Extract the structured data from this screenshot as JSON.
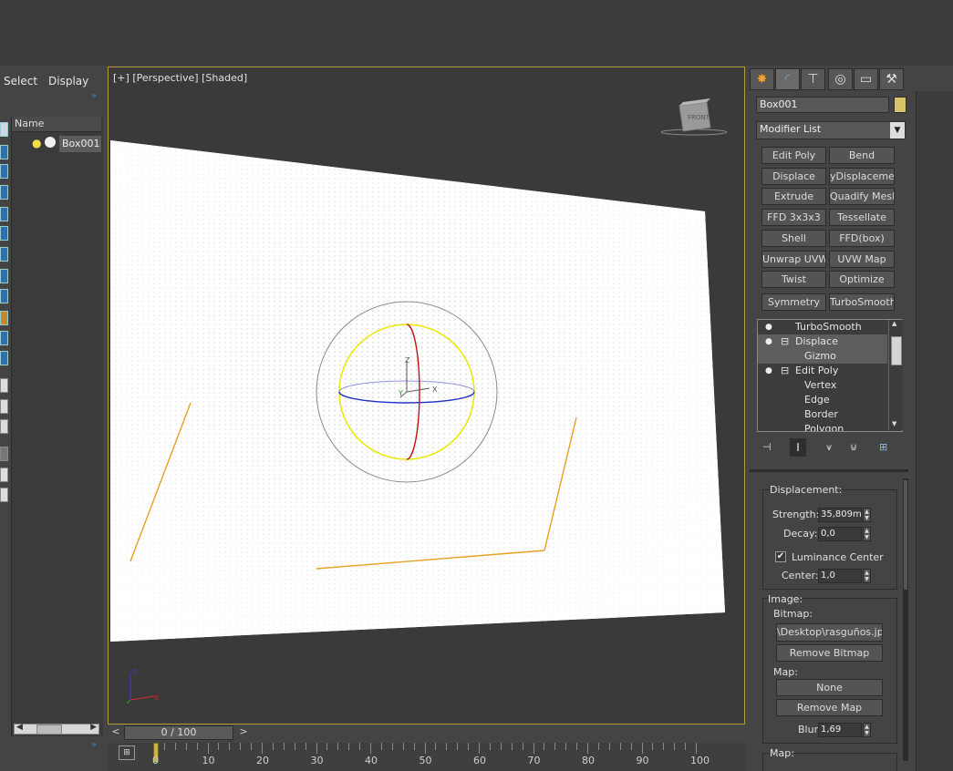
{
  "menu": {
    "select": "Select",
    "display": "Display",
    "more": "»"
  },
  "explorer": {
    "header": "Name",
    "objects": [
      {
        "name": "Box001"
      }
    ]
  },
  "viewport": {
    "plus": "[+]",
    "view": "[Perspective]",
    "shading": "[Shaded]",
    "viewcube": "FRONT",
    "gizmo_axes": {
      "x": "X",
      "y": "Y",
      "z": "Z"
    }
  },
  "command_panel": {
    "tabs": [
      {
        "icon": "create-icon",
        "glyph": "✸"
      },
      {
        "icon": "modify-icon",
        "glyph": "◜"
      },
      {
        "icon": "hierarchy-icon",
        "glyph": "⊤"
      },
      {
        "icon": "motion-icon",
        "glyph": "◎"
      },
      {
        "icon": "display-icon",
        "glyph": "▭"
      },
      {
        "icon": "utilities-icon",
        "glyph": "⚒"
      }
    ],
    "object_name": "Box001",
    "object_color": "#d9c46a",
    "modifier_list": "Modifier List",
    "modifier_buttons": [
      "Edit Poly",
      "Bend",
      "Displace",
      "yDisplacement",
      "Extrude",
      "Quadify Mesh",
      "FFD 3x3x3",
      "Tessellate",
      "Shell",
      "FFD(box)",
      "Unwrap UVW",
      "UVW Map",
      "Twist",
      "Optimize",
      "Symmetry",
      "TurboSmooth"
    ],
    "stack": [
      {
        "label": "TurboSmooth",
        "level": 0,
        "expand": ""
      },
      {
        "label": "Displace",
        "level": 0,
        "expand": "⊟"
      },
      {
        "label": "Gizmo",
        "level": 1,
        "expand": ""
      },
      {
        "label": "Edit Poly",
        "level": 0,
        "expand": "⊟"
      },
      {
        "label": "Vertex",
        "level": 1,
        "expand": ""
      },
      {
        "label": "Edge",
        "level": 1,
        "expand": ""
      },
      {
        "label": "Border",
        "level": 1,
        "expand": ""
      },
      {
        "label": "Polygon",
        "level": 1,
        "expand": ""
      }
    ],
    "displacement": {
      "title": "Displacement:",
      "strength_label": "Strength:",
      "strength_value": "35,809mm",
      "decay_label": "Decay:",
      "decay_value": "0,0",
      "luminance_label": "Luminance Center",
      "luminance_checked": true,
      "center_label": "Center:",
      "center_value": "1,0"
    },
    "image": {
      "title": "Image:",
      "bitmap_label": "Bitmap:",
      "bitmap_value": "\\Desktop\\rasguños.jpg",
      "remove_bitmap": "Remove Bitmap",
      "map_label": "Map:",
      "map_value": "None",
      "remove_map": "Remove Map",
      "blur_label": "Blur:",
      "blur_value": "1,69"
    },
    "map_title": "Map:"
  },
  "timeline": {
    "frame": "0 / 100",
    "prev": "<",
    "next": ">",
    "ticks": [
      "0",
      "10",
      "20",
      "30",
      "40",
      "50",
      "60",
      "70",
      "80",
      "90",
      "100"
    ]
  },
  "colors": {
    "selection": "#e8a020",
    "gizmo_yellow": "#e8e800",
    "viewport_border": "#b69b3c"
  }
}
